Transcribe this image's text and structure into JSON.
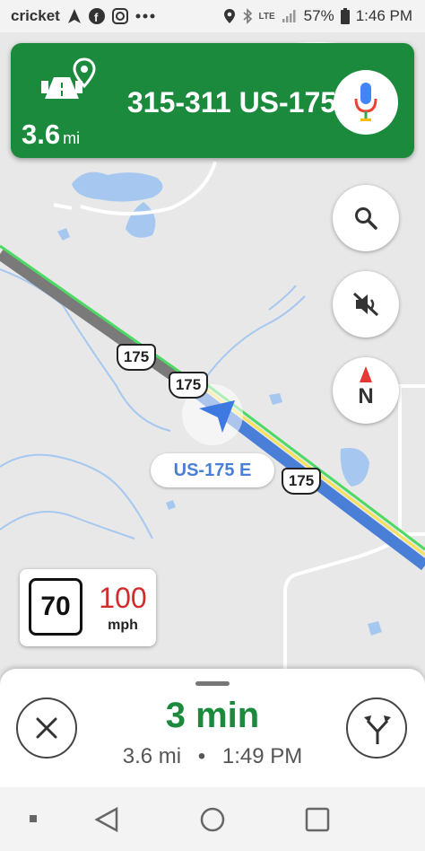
{
  "status_bar": {
    "carrier": "cricket",
    "network": "LTE",
    "battery": "57%",
    "time": "1:46 PM",
    "icons": [
      "navigation-arrow-icon",
      "facebook-icon",
      "instagram-icon",
      "more-dots-icon",
      "location-icon",
      "bluetooth-icon",
      "signal-icon",
      "battery-icon"
    ]
  },
  "nav_card": {
    "distance_value": "3.6",
    "distance_unit": "mi",
    "street": "315-311 US-175",
    "icons": [
      "highway-destination-icon",
      "mic-icon"
    ]
  },
  "map": {
    "shields": [
      "175",
      "175",
      "175"
    ],
    "road_label": "US-175 E",
    "buttons": [
      "search-icon",
      "mute-icon",
      "compass-icon"
    ],
    "compass_label": "N",
    "colors": {
      "route": "#4a7fd8",
      "traffic_green": "#4cd964",
      "traffic_yellow": "#f5e15a",
      "travelled": "#7a7a7a",
      "water": "#a6c8f0",
      "land": "#e8e8e8"
    }
  },
  "speed": {
    "limit": "70",
    "current": "100",
    "unit": "mph"
  },
  "bottom_sheet": {
    "eta": "3 min",
    "trip_distance": "3.6 mi",
    "arrival": "1:49 PM",
    "separator": "•",
    "icons": [
      "close-icon",
      "alternate-routes-icon"
    ]
  },
  "nav_bar": {
    "icons": [
      "recent-apps-icon",
      "back-icon",
      "home-icon",
      "overview-icon"
    ]
  }
}
